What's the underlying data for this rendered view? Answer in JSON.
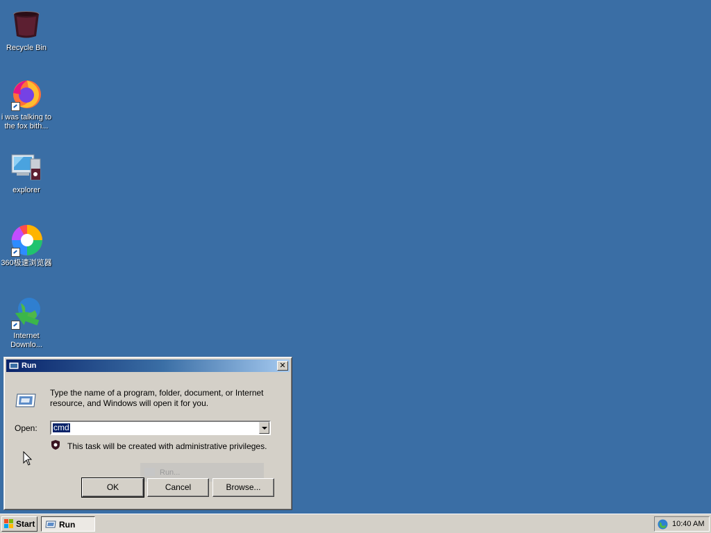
{
  "desktop": {
    "background": "#3a6ea5",
    "icons": [
      {
        "label": "Recycle Bin",
        "icon": "recycle-bin-icon"
      },
      {
        "label": "i was talking to the fox bith...",
        "icon": "firefox-icon"
      },
      {
        "label": "explorer",
        "icon": "computer-icon"
      },
      {
        "label": "360极速浏览器",
        "icon": "360-browser-icon"
      },
      {
        "label": "Internet Downlo...",
        "icon": "internet-download-manager-icon"
      }
    ]
  },
  "run_dialog": {
    "title": "Run",
    "description": "Type the name of a program, folder, document, or Internet resource, and Windows will open it for you.",
    "open_label": "Open:",
    "open_value": "cmd",
    "admin_note": "This task will be created with administrative privileges.",
    "ghost_item": "Run...",
    "buttons": {
      "ok": "OK",
      "cancel": "Cancel",
      "browse": "Browse..."
    }
  },
  "taskbar": {
    "start_label": "Start",
    "task_label": "Run",
    "clock": "10:40 AM"
  }
}
